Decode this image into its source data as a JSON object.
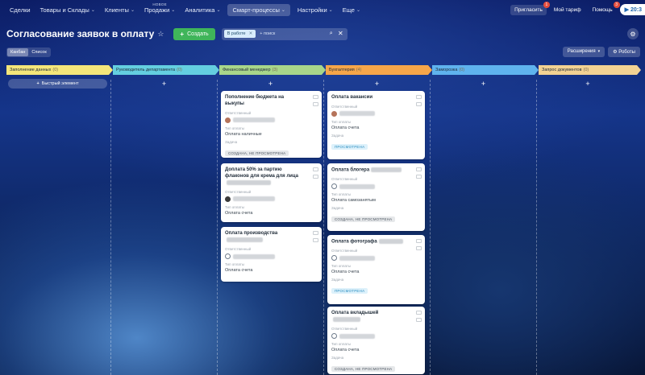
{
  "nav": {
    "items": [
      {
        "label": "Сделки",
        "chevron": false,
        "badge": "",
        "active": false
      },
      {
        "label": "Товары и Склады",
        "chevron": true,
        "badge": "",
        "active": false
      },
      {
        "label": "Клиенты",
        "chevron": true,
        "badge": "",
        "active": false
      },
      {
        "label": "Продажи",
        "chevron": true,
        "badge": "НОВОЕ",
        "active": false
      },
      {
        "label": "Аналитика",
        "chevron": true,
        "badge": "",
        "active": false
      },
      {
        "label": "Смарт-процессы",
        "chevron": true,
        "badge": "",
        "active": true
      },
      {
        "label": "Настройки",
        "chevron": true,
        "badge": "",
        "active": false
      },
      {
        "label": "Еще",
        "chevron": true,
        "badge": "",
        "active": false
      }
    ],
    "invite": {
      "label": "Пригласить",
      "count": "1"
    },
    "tariff": "Мой тариф",
    "help": {
      "label": "Помощь",
      "count": "3"
    },
    "clock": "20:3"
  },
  "toolbar": {
    "title": "Согласование заявок в оплату",
    "create_label": "Создать",
    "filter_chip": "В работе",
    "search_placeholder": "+ поиск"
  },
  "views": {
    "kanban": "Канбан",
    "list": "Список"
  },
  "tools": {
    "extensions": "Расширения",
    "robots": "Роботы"
  },
  "quick_add": "Быстрый элемент",
  "columns": [
    {
      "title": "Заполнение данных",
      "count": "(0)",
      "color": "#f4e67a"
    },
    {
      "title": "Руководитель департамента",
      "count": "(0)",
      "color": "#64cfe0"
    },
    {
      "title": "Финансовый менеджер",
      "count": "(3)",
      "color": "#a8d68a"
    },
    {
      "title": "Бухгалтерия",
      "count": "(4)",
      "color": "#f6a649"
    },
    {
      "title": "Заморозка",
      "count": "(0)",
      "color": "#5fb3ee"
    },
    {
      "title": "Запрос документов",
      "count": "(0)",
      "color": "#f2d293"
    }
  ],
  "labels": {
    "responsible": "Ответственный",
    "pay_type": "Тип оплаты",
    "task": "Задача"
  },
  "cards": {
    "c1": {
      "title": "Пополнение бюджета на выкупы",
      "pay": "Оплата наличные",
      "status": "СОЗДАНА, НЕ ПРОСМОТРЕНА"
    },
    "c2": {
      "title": "Доплата 50% за партию флаконов для крема для лица",
      "pay": "Оплата счета"
    },
    "c3": {
      "title": "Оплата производства",
      "pay": "Оплата счета"
    },
    "c4": {
      "title": "Оплата вакансии",
      "pay": "Оплата счета",
      "status": "ПРОСМОТРЕНА"
    },
    "c5": {
      "title": "Оплата блогера",
      "pay": "Оплата самозанятым",
      "status": "СОЗДАНА, НЕ ПРОСМОТРЕНА"
    },
    "c6": {
      "title": "Оплата фотографа",
      "pay": "Оплата счета",
      "status": "ПРОСМОТРЕНА"
    },
    "c7": {
      "title": "Оплата вкладышей",
      "pay": "Оплата счета",
      "status": "СОЗДАНА, НЕ ПРОСМОТРЕНА"
    }
  }
}
